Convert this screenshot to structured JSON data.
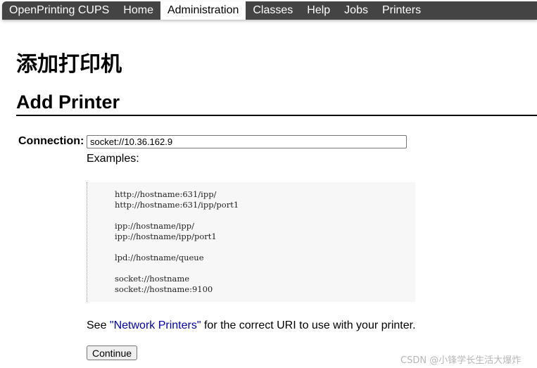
{
  "nav": {
    "brand": "OpenPrinting CUPS",
    "items": [
      "Home",
      "Administration",
      "Classes",
      "Help",
      "Jobs",
      "Printers"
    ],
    "active_item": "Administration"
  },
  "page": {
    "title_cn": "添加打印机",
    "heading": "Add Printer"
  },
  "form": {
    "connection_label": "Connection:",
    "connection_value": "socket://10.36.162.9",
    "examples_label": "Examples:",
    "examples": "http://hostname:631/ipp/\nhttp://hostname:631/ipp/port1\n\nipp://hostname/ipp/\nipp://hostname/ipp/port1\n\nlpd://hostname/queue\n\nsocket://hostname\nsocket://hostname:9100",
    "hint_before": "See ",
    "hint_link": "\"Network Printers\"",
    "hint_after": " for the correct URI to use with your printer.",
    "continue_label": "Continue"
  },
  "watermark": "CSDN @小锋学长生活大爆炸",
  "colors": {
    "navbar_bg": "#444444",
    "link": "#0000aa",
    "examples_bg": "#f7f7f7"
  }
}
